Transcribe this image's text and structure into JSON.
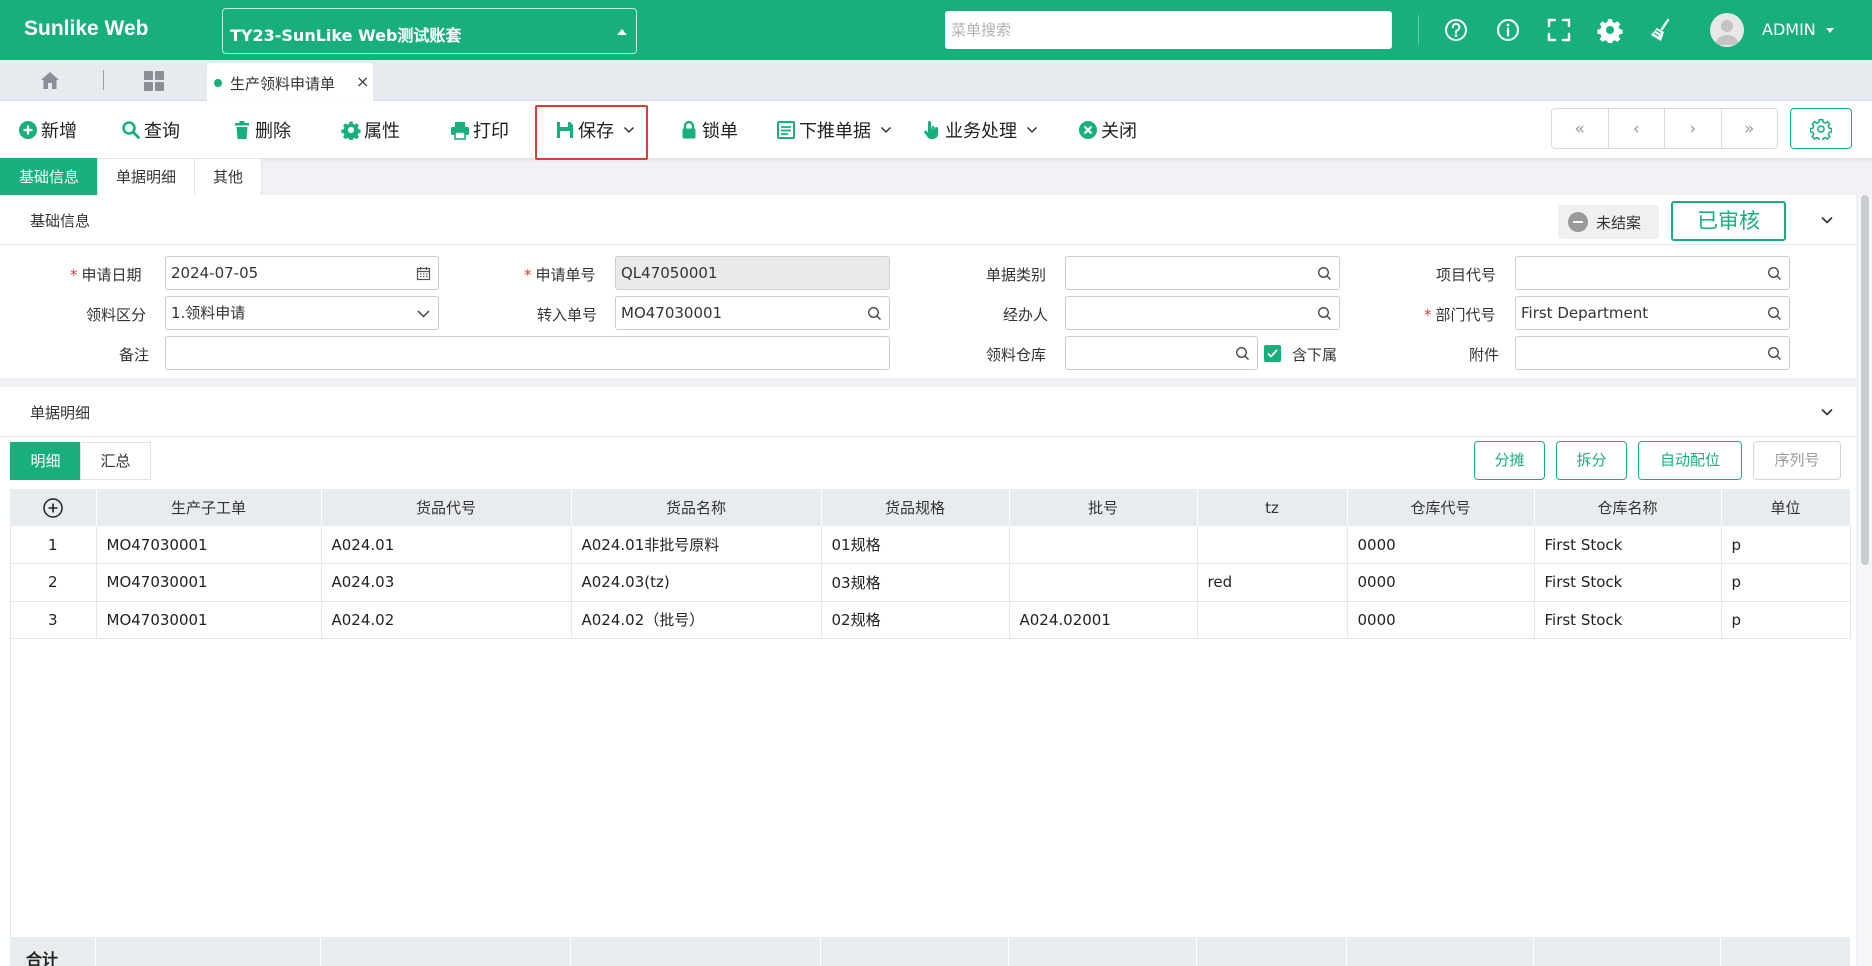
{
  "app": {
    "brand": "Sunlike Web",
    "account": "TY23-SunLike Web测试账套",
    "menu_search_placeholder": "菜单搜索",
    "user": "ADMIN",
    "top_icons": [
      "help-icon",
      "info-icon",
      "fullscreen-icon",
      "settings-gear-icon",
      "broom-clean-icon"
    ],
    "accent_color": "#17b07a"
  },
  "tabs": {
    "home_icon": "home-icon",
    "grid_icon": "grid-icon",
    "open_tab": {
      "label": "生产领料申请单",
      "close": "×"
    }
  },
  "toolbar": {
    "new": "新增",
    "query": "查询",
    "delete": "删除",
    "properties": "属性",
    "print": "打印",
    "save": "保存",
    "lock": "锁单",
    "push": "下推单据",
    "business": "业务处理",
    "close": "关闭",
    "nav": [
      "«",
      "‹",
      "›",
      "»"
    ]
  },
  "section_tabs": [
    "基础信息",
    "单据明细",
    "其他"
  ],
  "basic": {
    "title": "基础信息",
    "status": "未结案",
    "audit_stamp": "已审核",
    "fields": {
      "apply_date_label": "申请日期",
      "apply_date": "2024-07-05",
      "apply_no_label": "申请单号",
      "apply_no": "QL47050001",
      "doc_type_label": "单据类别",
      "doc_type": "",
      "project_label": "项目代号",
      "project": "",
      "pick_type_label": "领料区分",
      "pick_type": "1.领料申请",
      "transfer_no_label": "转入单号",
      "transfer_no": "MO47030001",
      "handler_label": "经办人",
      "handler": "",
      "dept_label": "部门代号",
      "dept": "First Department",
      "remark_label": "备注",
      "remark": "",
      "warehouse_label": "领料仓库",
      "warehouse": "",
      "include_sub_label": "含下属",
      "include_sub_checked": true,
      "attachment_label": "附件",
      "attachment": ""
    }
  },
  "detail": {
    "title": "单据明细",
    "sub_tabs": [
      "明细",
      "汇总"
    ],
    "actions": [
      "分摊",
      "拆分",
      "自动配位",
      "序列号"
    ],
    "columns": [
      "生产子工单",
      "货品代号",
      "货品名称",
      "货品规格",
      "批号",
      "tz",
      "仓库代号",
      "仓库名称",
      "单位"
    ],
    "rows": [
      [
        "1",
        "MO47030001",
        "A024.01",
        "A024.01非批号原料",
        "01规格",
        "",
        "",
        "0000",
        "First Stock",
        "p"
      ],
      [
        "2",
        "MO47030001",
        "A024.03",
        "A024.03(tz)",
        "03规格",
        "",
        "red",
        "0000",
        "First Stock",
        "p"
      ],
      [
        "3",
        "MO47030001",
        "A024.02",
        "A024.02（批号）",
        "02规格",
        "A024.02001",
        "",
        "0000",
        "First Stock",
        "p"
      ]
    ],
    "total_label": "合计"
  }
}
